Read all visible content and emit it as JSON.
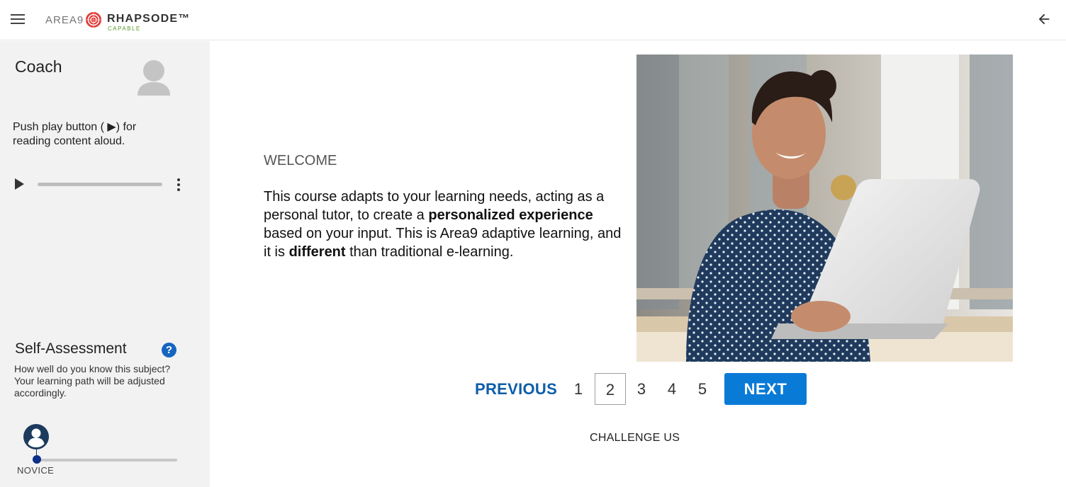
{
  "app": {
    "logo_left": "AREA9",
    "logo_brand": "RHAPSODE™",
    "logo_tagline": "CAPABLE",
    "menu_icon": "hamburger-menu-icon",
    "back_icon": "arrow-back-icon"
  },
  "sidebar": {
    "coach_title": "Coach",
    "coach_avatar_icon": "person-avatar-icon",
    "coach_text": "Push play button ( ▶) for reading content aloud.",
    "audio": {
      "play_icon": "play-icon",
      "more_icon": "more-vertical-icon",
      "progress": 0
    },
    "self_assessment": {
      "title": "Self-Assessment",
      "help_label": "?",
      "description": "How well do you know this subject? Your learning path will be adjusted accordingly.",
      "level_label": "NOVICE",
      "level_value": 0
    }
  },
  "main": {
    "heading": "WELCOME",
    "body_parts": [
      "This course adapts to your learning needs, acting as a personal tutor, to create a ",
      "personalized experience",
      " based on your input. This is Area9 adaptive learning, and it is ",
      "different",
      " than traditional e-learning."
    ],
    "image_alt": "Smiling woman in a polka-dot blouse working on a laptop"
  },
  "pager": {
    "previous_label": "PREVIOUS",
    "pages": [
      "1",
      "2",
      "3",
      "4",
      "5"
    ],
    "current_page": "2",
    "next_label": "NEXT"
  },
  "challenge_label": "CHALLENGE US",
  "colors": {
    "primary": "#0a7ad7",
    "link": "#0d5ea8",
    "sidebar_bg": "#f2f2f2",
    "help_icon": "#1565c0",
    "level_knob": "#0d2f8a"
  }
}
